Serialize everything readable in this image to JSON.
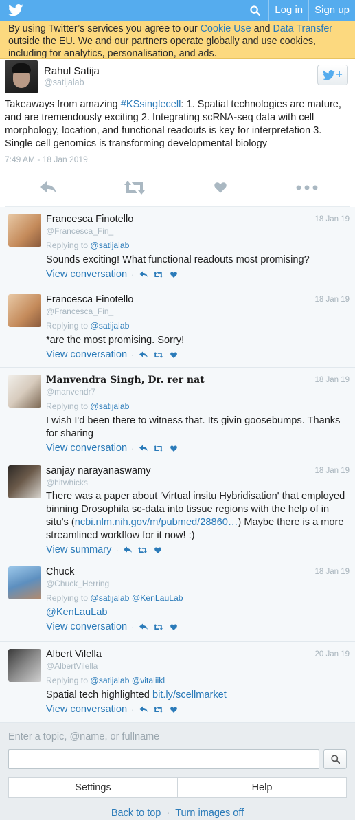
{
  "topbar": {
    "login": "Log in",
    "signup": "Sign up"
  },
  "notice": {
    "p1": "By using Twitter’s services you agree to our ",
    "cookie_link": "Cookie Use",
    "p2": " and ",
    "transfer_link": "Data Transfer",
    "p3": " outside the EU. We and our partners operate globally and use cookies, including for analytics, personalisation, and ads."
  },
  "tweet": {
    "author_name": "Rahul Satija",
    "author_handle": "@satijalab",
    "text_before": "Takeaways from amazing ",
    "hashtag": "#KSsinglecell",
    "text_after": ": 1. Spatial technologies are mature, and are tremendously exciting 2. Integrating scRNA-seq data with cell morphology, location, and functional readouts is key for interpretation 3. Single cell genomics is transforming developmental biology",
    "timestamp": "7:49 AM - 18 Jan 2019"
  },
  "replies": [
    {
      "name": "Francesca Finotello",
      "handle": "@Francesca_Fin_",
      "date": "18 Jan 19",
      "replying_prefix": "Replying to ",
      "replying_to": "@satijalab",
      "text": "Sounds exciting! What functional readouts most promising?",
      "footer_link": "View conversation"
    },
    {
      "name": "Francesca Finotello",
      "handle": "@Francesca_Fin_",
      "date": "18 Jan 19",
      "replying_prefix": "Replying to ",
      "replying_to": "@satijalab",
      "text": "*are the most promising. Sorry!",
      "footer_link": "View conversation"
    },
    {
      "name": "Manvendra Singh, Dr. rer nat",
      "handle": "@manvendr7",
      "date": "18 Jan 19",
      "replying_prefix": "Replying to ",
      "replying_to": "@satijalab",
      "text": "I wish I'd been there to witness that. Its givin goosebumps. Thanks for sharing",
      "footer_link": "View conversation"
    },
    {
      "name": "sanjay narayanaswamy",
      "handle": "@hitwhicks",
      "date": "18 Jan 19",
      "text_before": "There was a paper about 'Virtual insitu Hybridisation' that employed binning Drosophila sc-data into tissue regions with the help of in situ's (",
      "text_link": "ncbi.nlm.nih.gov/m/pubmed/28860…",
      "text_after": ") Maybe there is a more streamlined workflow for it now! :)",
      "footer_link": "View summary"
    },
    {
      "name": "Chuck",
      "handle": "@Chuck_Herring",
      "date": "18 Jan 19",
      "replying_prefix": "Replying to ",
      "replying_to": "@satijalab @KenLauLab",
      "text_link_only": "@KenLauLab",
      "footer_link": "View conversation"
    },
    {
      "name": "Albert Vilella",
      "handle": "@AlbertVilella",
      "date": "20 Jan 19",
      "replying_prefix": "Replying to ",
      "replying_to": "@satijalab @vitaliikl",
      "text_before": "Spatial tech highlighted ",
      "text_link": "bit.ly/scellmarket",
      "footer_link": "View conversation"
    }
  ],
  "bottom": {
    "search_placeholder": "Enter a topic, @name, or fullname",
    "settings": "Settings",
    "help": "Help",
    "back_to_top": "Back to top",
    "separator": "·",
    "images_off": "Turn images off"
  },
  "colors": {
    "brand": "#55acee",
    "link": "#2b7bb9",
    "notice": "#fcd97f"
  }
}
